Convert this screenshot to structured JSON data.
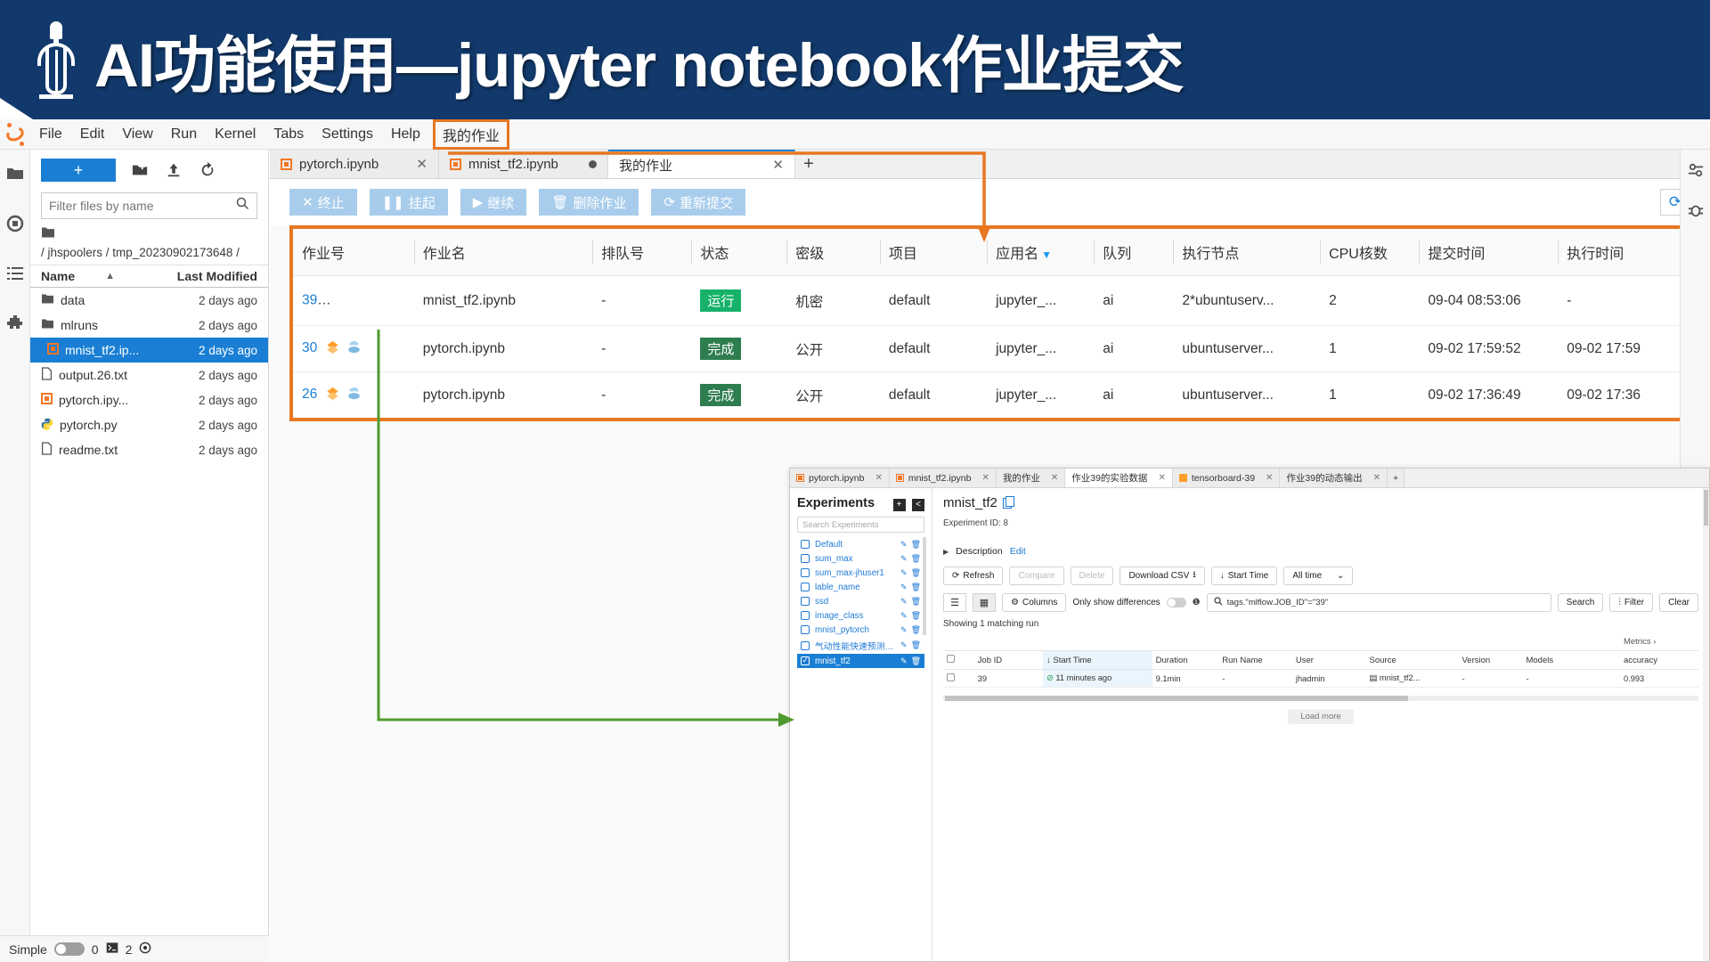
{
  "banner": {
    "title": "AI功能使用—jupyter notebook作业提交",
    "logo_icon": "lamp-icon",
    "bg": "#12396b"
  },
  "lab": {
    "menubar": {
      "logo_icon": "jupyter-logo-icon",
      "items": [
        {
          "label": "File"
        },
        {
          "label": "Edit"
        },
        {
          "label": "View"
        },
        {
          "label": "Run"
        },
        {
          "label": "Kernel"
        },
        {
          "label": "Tabs"
        },
        {
          "label": "Settings"
        },
        {
          "label": "Help"
        },
        {
          "label": "我的作业",
          "highlighted": true
        }
      ]
    },
    "left_rail": [
      "folder-icon",
      "running-icon",
      "commands-icon",
      "extensions-icon"
    ],
    "right_rail": [
      "property-inspector-icon",
      "debugger-icon"
    ],
    "filebrowser": {
      "new_label": "+",
      "tool_icons": [
        "new-folder-icon",
        "upload-icon",
        "refresh-icon"
      ],
      "filter_placeholder": "Filter files by name",
      "search_icon": "search-icon",
      "breadcrumb": "/ jhspoolers / tmp_20230902173648 /",
      "columns": {
        "name": "Name",
        "modified": "Last Modified"
      },
      "sort_icon": "caret-up-icon",
      "files": [
        {
          "name": "data",
          "modified": "2 days ago",
          "type": "folder",
          "selected": false,
          "running": false
        },
        {
          "name": "mlruns",
          "modified": "2 days ago",
          "type": "folder",
          "selected": false,
          "running": false
        },
        {
          "name": "mnist_tf2.ip...",
          "modified": "2 days ago",
          "type": "notebook",
          "selected": true,
          "running": true
        },
        {
          "name": "output.26.txt",
          "modified": "2 days ago",
          "type": "file",
          "selected": false,
          "running": false
        },
        {
          "name": "pytorch.ipy...",
          "modified": "2 days ago",
          "type": "notebook",
          "selected": false,
          "running": false
        },
        {
          "name": "pytorch.py",
          "modified": "2 days ago",
          "type": "python",
          "selected": false,
          "running": false
        },
        {
          "name": "readme.txt",
          "modified": "2 days ago",
          "type": "file",
          "selected": false,
          "running": false
        }
      ]
    },
    "statusbar": {
      "mode": "Simple",
      "kernel_count": "0",
      "terminal_count": "2",
      "terminal_icon": "terminal-icon",
      "settings_icon": "gear-icon"
    },
    "tabs": [
      {
        "label": "pytorch.ipynb",
        "icon": "notebook-icon",
        "closable": true,
        "active": false,
        "dirty": false
      },
      {
        "label": "mnist_tf2.ipynb",
        "icon": "notebook-icon",
        "closable": false,
        "active": false,
        "dirty": true
      },
      {
        "label": "我的作业",
        "icon": "none",
        "closable": true,
        "active": true,
        "dirty": false
      }
    ],
    "tab_add_label": "+"
  },
  "jobs_panel": {
    "toolbar": [
      {
        "label": "终止",
        "icon": "✕"
      },
      {
        "label": "挂起",
        "icon": "❚❚"
      },
      {
        "label": "继续",
        "icon": "▶"
      },
      {
        "label": "删除作业",
        "icon": "🗑"
      },
      {
        "label": "重新提交",
        "icon": "⟳"
      }
    ],
    "refresh_icon": "refresh-icon",
    "columns": [
      "作业号",
      "作业名",
      "排队号",
      "状态",
      "密级",
      "项目",
      "应用名",
      "队列",
      "执行节点",
      "CPU核数",
      "提交时间",
      "执行时间"
    ],
    "filtered_column": "应用名",
    "rows": [
      {
        "job_id": "39",
        "icons": [
          "log-icon",
          "tensorboard-icon",
          "mlflow-icon"
        ],
        "icons_highlighted": true,
        "job_name": "mnist_tf2.ipynb",
        "queue_no": "-",
        "status": "运行",
        "status_kind": "run",
        "secrecy": "机密",
        "project": "default",
        "app_name": "jupyter_...",
        "queue": "ai",
        "node": "2*ubuntuserv...",
        "cpu_cores": "2",
        "submit_time": "09-04 08:53:06",
        "exec_time": "-"
      },
      {
        "job_id": "30",
        "icons": [
          "tensorboard-icon",
          "mlflow-icon"
        ],
        "icons_highlighted": false,
        "job_name": "pytorch.ipynb",
        "queue_no": "-",
        "status": "完成",
        "status_kind": "done",
        "secrecy": "公开",
        "project": "default",
        "app_name": "jupyter_...",
        "queue": "ai",
        "node": "ubuntuserver...",
        "cpu_cores": "1",
        "submit_time": "09-02 17:59:52",
        "exec_time": "09-02 17:59"
      },
      {
        "job_id": "26",
        "icons": [
          "tensorboard-icon",
          "mlflow-icon"
        ],
        "icons_highlighted": false,
        "job_name": "pytorch.ipynb",
        "queue_no": "-",
        "status": "完成",
        "status_kind": "done",
        "secrecy": "公开",
        "project": "default",
        "app_name": "jupyter_...",
        "queue": "ai",
        "node": "ubuntuserver...",
        "cpu_cores": "1",
        "submit_time": "09-02 17:36:49",
        "exec_time": "09-02 17:36"
      }
    ]
  },
  "mlflow_window": {
    "tabs": [
      {
        "label": "pytorch.ipynb",
        "icon": "notebook-icon",
        "active": false
      },
      {
        "label": "mnist_tf2.ipynb",
        "icon": "notebook-icon",
        "active": false
      },
      {
        "label": "我的作业",
        "icon": "none",
        "active": false
      },
      {
        "label": "作业39的实验数据",
        "icon": "none",
        "active": true
      },
      {
        "label": "tensorboard-39",
        "icon": "tb-icon",
        "active": false
      },
      {
        "label": "作业39的动态输出",
        "icon": "none",
        "active": false
      }
    ],
    "tab_add_label": "+",
    "experiments": {
      "title": "Experiments",
      "add_label": "+",
      "collapse_label": "<",
      "search_placeholder": "Search Experiments",
      "edit_icon": "pencil-icon",
      "delete_icon": "trash-icon",
      "items": [
        {
          "label": "Default",
          "selected": false
        },
        {
          "label": "sum_max",
          "selected": false
        },
        {
          "label": "sum_max-jhuser1",
          "selected": false
        },
        {
          "label": "lable_name",
          "selected": false
        },
        {
          "label": "ssd",
          "selected": false
        },
        {
          "label": "image_class",
          "selected": false
        },
        {
          "label": "mnist_pytorch",
          "selected": false
        },
        {
          "label": "气动性能快速预测_模型_...",
          "selected": false
        },
        {
          "label": "mnist_tf2",
          "selected": true
        }
      ]
    },
    "detail": {
      "title": "mnist_tf2",
      "copy_icon": "copy-icon",
      "experiment_id_label": "Experiment ID:",
      "experiment_id": "8",
      "description_label": "Description",
      "edit_label": "Edit",
      "buttons": [
        {
          "label": "Refresh",
          "icon": "refresh-icon",
          "disabled": false
        },
        {
          "label": "Compare",
          "icon": "none",
          "disabled": true
        },
        {
          "label": "Delete",
          "icon": "none",
          "disabled": true
        },
        {
          "label": "Download CSV",
          "icon": "download-icon",
          "disabled": false
        },
        {
          "label": "Start Time",
          "icon": "sort-down-icon",
          "disabled": false
        },
        {
          "label": "All time",
          "icon": "chevron-down-icon",
          "disabled": false
        }
      ],
      "view_list_icon": "list-view-icon",
      "view_grid_icon": "grid-view-icon",
      "columns_label": "Columns",
      "columns_icon": "gear-icon",
      "differences_label": "Only show differences",
      "info_icon": "info-icon",
      "search_icon": "search-icon",
      "search_value": "tags.\"mlflow.JOB_ID\"=\"39\"",
      "search_button": "Search",
      "filter_button": "Filter",
      "filter_icon": "filter-icon",
      "clear_button": "Clear",
      "showing_text": "Showing 1 matching run",
      "metrics_group": "Metrics",
      "metrics_group_icon": "chevron-right-icon",
      "table_columns": [
        "Job ID",
        "Start Time",
        "Duration",
        "Run Name",
        "User",
        "Source",
        "Version",
        "Models",
        "accuracy"
      ],
      "sort_indicator": "↓",
      "rows": [
        {
          "job_id": "39",
          "start_time": "11 minutes ago",
          "start_time_icon": "check-circle-icon",
          "duration": "9.1min",
          "run_name": "-",
          "user": "jhadmin",
          "source": "mnist_tf2...",
          "source_icon": "notebook-small-icon",
          "version": "-",
          "models": "-",
          "accuracy": "0.993"
        }
      ],
      "load_more": "Load more"
    }
  },
  "annotations": {
    "orange_color": "#e87722",
    "green_color": "#4f9a2f",
    "menu_to_table_arrow": "我的作业 菜单指向作业表",
    "mlflow_icon_to_window_arrow": "mlflow 图标指向实验数据窗口"
  }
}
